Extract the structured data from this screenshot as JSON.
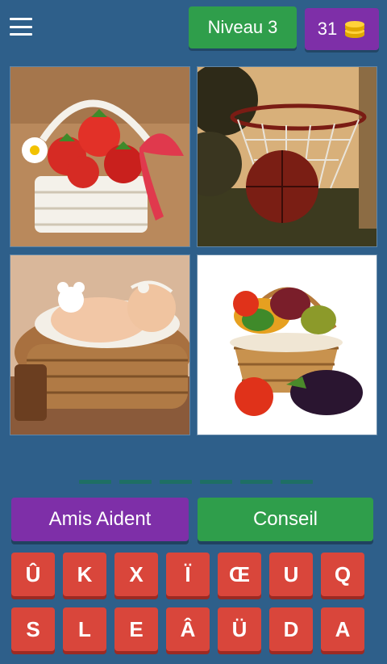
{
  "header": {
    "level_label": "Niveau 3",
    "coins": "31",
    "colors": {
      "level": "#2f9e4b",
      "coins": "#7e2fa8",
      "background": "#2e5f8a"
    }
  },
  "images": [
    {
      "subject": "strawberry-basket"
    },
    {
      "subject": "basketball-hoop"
    },
    {
      "subject": "baby-in-basket"
    },
    {
      "subject": "vegetable-basket"
    }
  ],
  "answer_slots": 6,
  "helpers": {
    "friends_label": "Amis Aident",
    "hint_label": "Conseil"
  },
  "keyboard": {
    "row1": [
      "Û",
      "K",
      "X",
      "Ï",
      "Œ",
      "U",
      "Q"
    ],
    "row2": [
      "S",
      "L",
      "E",
      "Â",
      "Ü",
      "D",
      "A"
    ]
  }
}
